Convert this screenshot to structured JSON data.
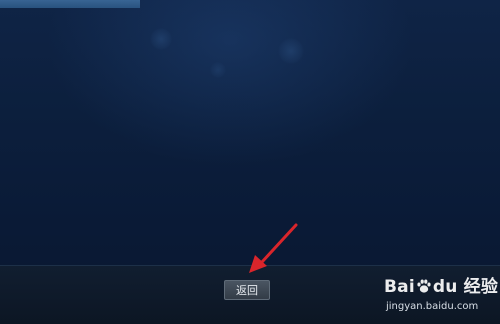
{
  "bottom_bar": {
    "back_button_label": "返回"
  },
  "watermark": {
    "brand_text_1": "Bai",
    "brand_text_2": "du",
    "brand_text_3": "经验",
    "url": "jingyan.baidu.com",
    "icon": "baidu-paw-icon"
  },
  "annotation": {
    "arrow_color": "#d9252b",
    "icon": "red-arrow-icon"
  },
  "colors": {
    "background": "#0c1f3d",
    "bottom_bar": "#0e1929",
    "button": "#3e4853",
    "button_text": "#e6eaef",
    "top_strip": "#3f6fa0"
  }
}
